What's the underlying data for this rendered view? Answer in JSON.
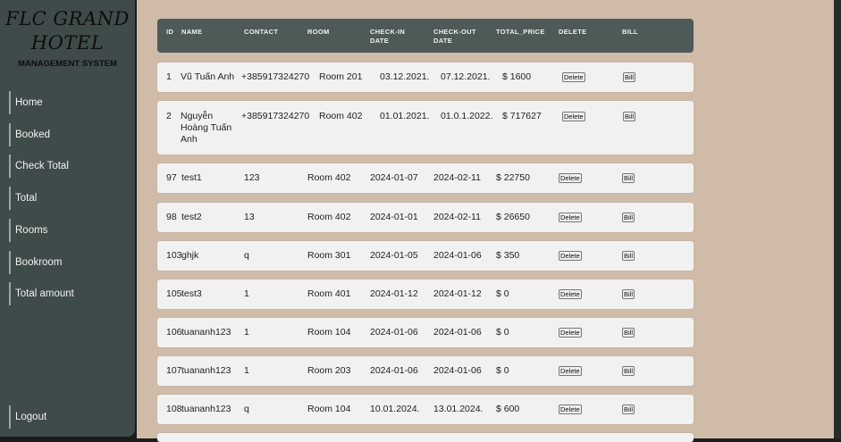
{
  "brand": {
    "title_line1": "FLC GRAND",
    "title_line2": "HOTEL",
    "subtitle": "MANAGEMENT SYSTEM"
  },
  "sidebar": {
    "items": [
      {
        "label": "Home"
      },
      {
        "label": "Booked"
      },
      {
        "label": "Check Total"
      },
      {
        "label": "Total"
      },
      {
        "label": "Rooms"
      },
      {
        "label": "Bookroom"
      },
      {
        "label": "Total amount"
      },
      {
        "label": "Logout"
      }
    ]
  },
  "table": {
    "columns": [
      "ID",
      "NAME",
      "CONTACT",
      "ROOM",
      "CHECK-IN DATE",
      "CHECK-OUT DATE",
      "TOTAL_PRICE",
      "DELETE",
      "BILL"
    ],
    "delete_label": "Delete",
    "bill_label": "Bill",
    "rows": [
      {
        "id": "1",
        "name": "Vũ Tuấn Anh",
        "contact": "+385917324270",
        "room": "Room 201",
        "check_in": "03.12.2021.",
        "check_out": "07.12.2021.",
        "price": "$ 1600"
      },
      {
        "id": "2",
        "name": "Nguyễn Hoàng Tuấn Anh",
        "contact": "+385917324270",
        "room": "Room 402",
        "check_in": "01.01.2021.",
        "check_out": "01.0.1.2022.",
        "price": "$ 717627"
      },
      {
        "id": "97",
        "name": "test1",
        "contact": "123",
        "room": "Room 402",
        "check_in": "2024-01-07",
        "check_out": "2024-02-11",
        "price": "$ 22750"
      },
      {
        "id": "98",
        "name": "test2",
        "contact": "13",
        "room": "Room 402",
        "check_in": "2024-01-01",
        "check_out": "2024-02-11",
        "price": "$ 26650"
      },
      {
        "id": "103",
        "name": "ghjk",
        "contact": "q",
        "room": "Room 301",
        "check_in": "2024-01-05",
        "check_out": "2024-01-06",
        "price": "$ 350"
      },
      {
        "id": "105",
        "name": "test3",
        "contact": "1",
        "room": "Room 401",
        "check_in": "2024-01-12",
        "check_out": "2024-01-12",
        "price": "$ 0"
      },
      {
        "id": "106",
        "name": "tuananh123",
        "contact": "1",
        "room": "Room 104",
        "check_in": "2024-01-06",
        "check_out": "2024-01-06",
        "price": "$ 0"
      },
      {
        "id": "107",
        "name": "tuananh123",
        "contact": "1",
        "room": "Room 203",
        "check_in": "2024-01-06",
        "check_out": "2024-01-06",
        "price": "$ 0"
      },
      {
        "id": "108",
        "name": "tuananh123",
        "contact": "q",
        "room": "Room 104",
        "check_in": "10.01.2024.",
        "check_out": "13.01.2024.",
        "price": "$ 600"
      }
    ]
  }
}
